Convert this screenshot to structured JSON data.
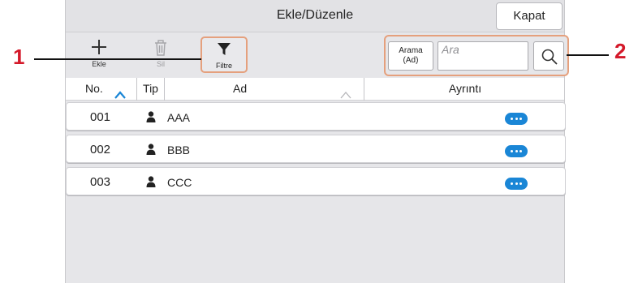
{
  "window": {
    "title": "Ekle/Düzenle",
    "close_label": "Kapat"
  },
  "toolbar": {
    "add_label": "Ekle",
    "delete_label": "Sil",
    "filter_label": "Filtre"
  },
  "search": {
    "mode_label_line1": "Arama",
    "mode_label_line2": "(Ad)",
    "placeholder": "Ara"
  },
  "columns": {
    "no": "No.",
    "type": "Tip",
    "name": "Ad",
    "details": "Ayrıntı"
  },
  "rows": [
    {
      "no": "001",
      "type_icon": "person-icon",
      "name": "AAA"
    },
    {
      "no": "002",
      "type_icon": "person-icon",
      "name": "BBB"
    },
    {
      "no": "003",
      "type_icon": "person-icon",
      "name": "CCC"
    }
  ],
  "callouts": [
    {
      "label": "1"
    },
    {
      "label": "2"
    }
  ],
  "colors": {
    "accent_blue": "#1a86d6",
    "callout_red": "#d4192a",
    "highlight_orange": "#e5a07d"
  }
}
